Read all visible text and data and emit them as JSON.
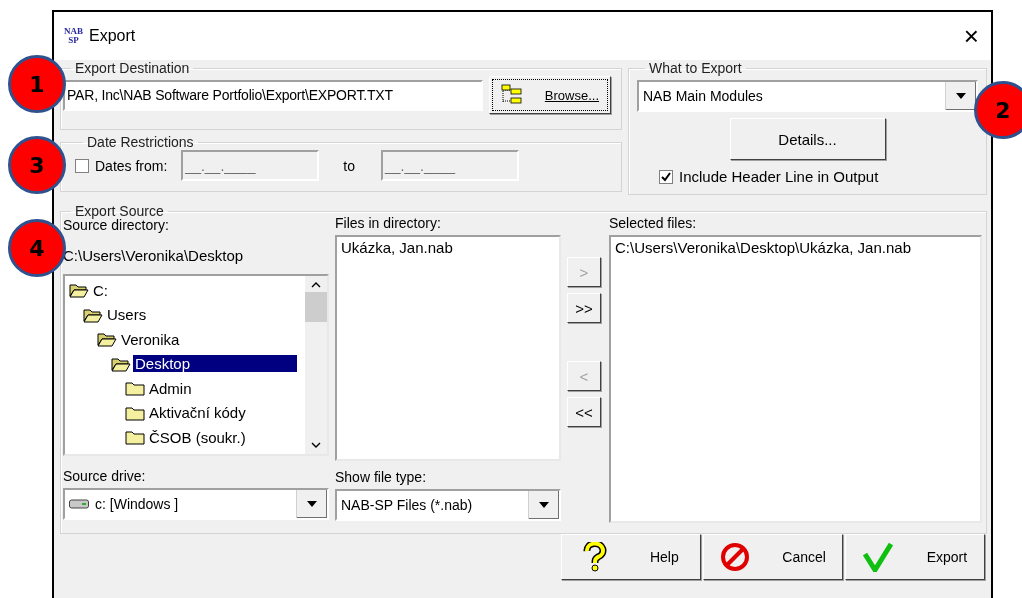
{
  "window": {
    "title": "Export",
    "app_icon_text": [
      "NAB",
      "SP"
    ],
    "close": "×"
  },
  "export_destination": {
    "callout": "1",
    "label": "Export Destination",
    "path": "PAR, Inc\\NAB Software Portfolio\\Export\\EXPORT.TXT",
    "browse_button": "Browse..."
  },
  "what_to_export": {
    "callout": "2",
    "label": "What to Export",
    "value": "NAB Main Modules",
    "details_button": "Details...",
    "include_header": {
      "label": "Include Header Line in Output",
      "checked": true
    }
  },
  "date_restrictions": {
    "callout": "3",
    "label": "Date Restrictions",
    "dates_from": {
      "label": "Dates from:",
      "checked": false
    },
    "from_value": "__.__.____",
    "to_label": "to",
    "to_value": "__.__.____"
  },
  "export_source": {
    "callout": "4",
    "label": "Export Source",
    "source_directory_label": "Source directory:",
    "current_directory": "C:\\Users\\Veronika\\Desktop",
    "tree": [
      {
        "name": "C:",
        "expanded": true,
        "selected": false,
        "children": [
          {
            "name": "Users",
            "expanded": true,
            "selected": false,
            "children": [
              {
                "name": "Veronika",
                "expanded": true,
                "selected": false,
                "children": [
                  {
                    "name": "Desktop",
                    "expanded": true,
                    "selected": true,
                    "children": [
                      {
                        "name": "Admin",
                        "expanded": false,
                        "selected": false
                      },
                      {
                        "name": "Aktivační kódy",
                        "expanded": false,
                        "selected": false
                      },
                      {
                        "name": "ČSOB (soukr.)",
                        "expanded": false,
                        "selected": false
                      }
                    ]
                  }
                ]
              }
            ]
          }
        ]
      }
    ],
    "files_label": "Files in directory:",
    "files": [
      "Ukázka, Jan.nab"
    ],
    "transfer_buttons": [
      {
        "label": ">",
        "disabled": true
      },
      {
        "label": ">>",
        "disabled": false
      },
      {
        "label": "<",
        "disabled": true
      },
      {
        "label": "<<",
        "disabled": false
      }
    ],
    "selected_files_label": "Selected files:",
    "selected_files": [
      "C:\\Users\\Veronika\\Desktop\\Ukázka, Jan.nab"
    ],
    "source_drive_label": "Source drive:",
    "source_drive": "c: [Windows ]",
    "file_type_label": "Show file type:",
    "file_type": "NAB-SP Files (*.nab)"
  },
  "buttons": [
    {
      "kind": "help",
      "label": "Help"
    },
    {
      "kind": "cancel",
      "label": "Cancel"
    },
    {
      "kind": "export",
      "label": "Export"
    }
  ]
}
